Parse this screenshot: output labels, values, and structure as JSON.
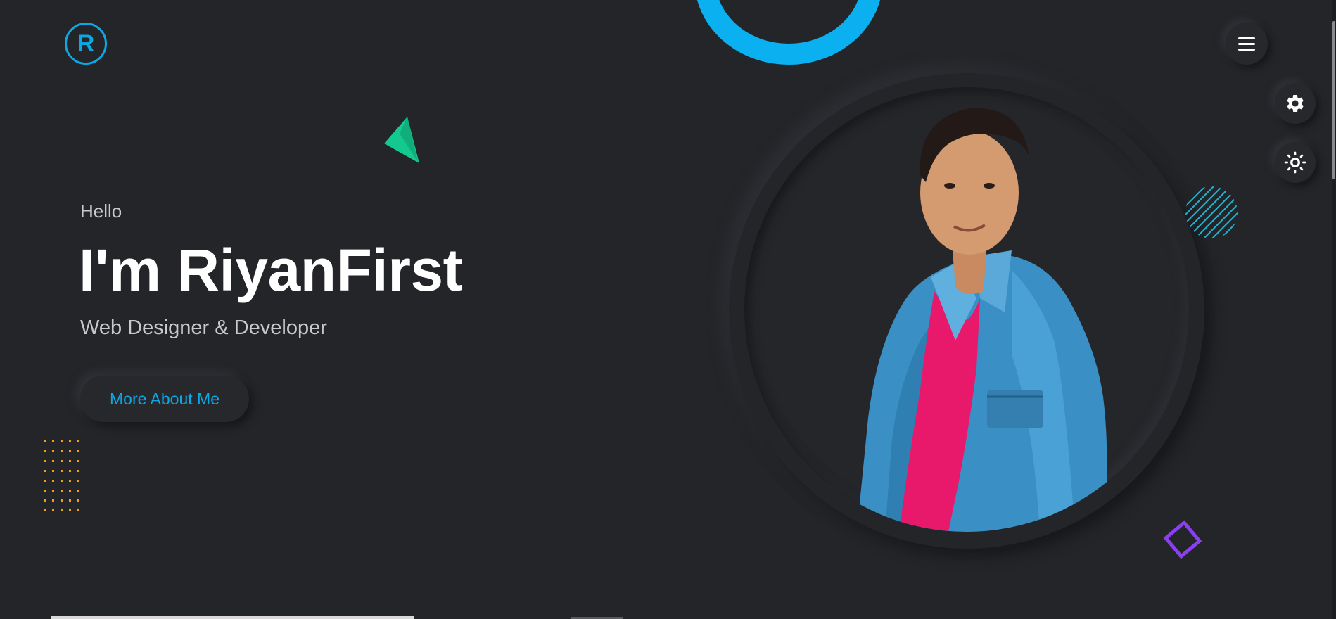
{
  "brand": {
    "logo_letter": "R"
  },
  "hero": {
    "greeting": "Hello",
    "headline": "I'm RiyanFirst",
    "role": "Web Designer & Developer",
    "cta_label": "More About Me"
  },
  "controls": {
    "menu_icon": "hamburger-icon",
    "settings_icon": "gear-icon",
    "theme_icon": "sun-icon"
  },
  "colors": {
    "background": "#242529",
    "accent_blue": "#0ba8e6",
    "triangle_green": "#13c98d",
    "dots_orange": "#f5a00a",
    "stripes_cyan": "#1fb6d6",
    "diamond_purple": "#8a3ff0"
  }
}
